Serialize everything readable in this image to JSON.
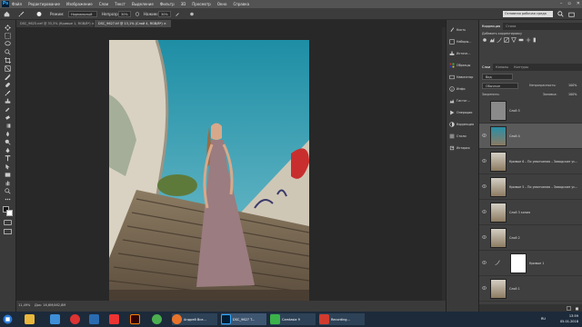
{
  "menubar": {
    "logo": "Ps",
    "items": [
      "Файл",
      "Редактирование",
      "Изображение",
      "Слои",
      "Текст",
      "Выделение",
      "Фильтр",
      "3D",
      "Просмотр",
      "Окно",
      "Справка"
    ],
    "window_buttons": [
      "–",
      "▫",
      "✕"
    ]
  },
  "optbar": {
    "mode_label": "Режим:",
    "mode_value": "Нормальный",
    "opacity_label": "Непрозр.:",
    "opacity_value": "30%",
    "flow_label": "Нажим:",
    "flow_value": "30%",
    "workspace": "Основная рабочая среда"
  },
  "tabs": [
    {
      "label": "DSC_9625.nef @ 33,3% (Кривые 1, RGB/8*) ×",
      "active": false
    },
    {
      "label": "DSC_9627.tif @ 13,1% (Слой 4, RGB/8*) ×",
      "active": true
    }
  ],
  "status": {
    "zoom": "11,49%",
    "doc": "Док: 16,6M/462,8M"
  },
  "strip": {
    "items": [
      {
        "icon": "history-icon",
        "label": "Кисть"
      },
      {
        "icon": "brush-icon",
        "label": "Наборы..."
      },
      {
        "icon": "clone-icon",
        "label": "Источн..."
      },
      {
        "icon": "swatch-icon",
        "label": "Образцы"
      },
      {
        "icon": "navigator-icon",
        "label": "Навигатор"
      },
      {
        "icon": "info-icon",
        "label": "Инфо"
      },
      {
        "icon": "histogram-icon",
        "label": "Гистог..."
      },
      {
        "icon": "actions-icon",
        "label": "Операции"
      },
      {
        "icon": "adjust-icon",
        "label": "Коррекция"
      },
      {
        "icon": "styles-icon",
        "label": "Стили"
      },
      {
        "icon": "history2-icon",
        "label": "История"
      }
    ]
  },
  "panel": {
    "top_tabs": [
      "Коррекция",
      "Стили"
    ],
    "top_hint": "Добавить корректировку",
    "layer_tabs": [
      "Слои",
      "Каналы",
      "Контуры"
    ],
    "kind_label": "Вид",
    "blend_mode": "Обычные",
    "opacity_label": "Непрозрачность:",
    "opacity_value": "100%",
    "lock_label": "Закрепить:",
    "fill_label": "Заливка:",
    "fill_value": "100%",
    "layers": [
      {
        "name": "Слой 5",
        "thumb": "gray",
        "selected": false,
        "eye": false
      },
      {
        "name": "Слой 4",
        "thumb": "photo",
        "selected": true,
        "eye": true
      },
      {
        "name": "Кривые 6 – По умолчанию – Заводские ус...",
        "thumb": "photo",
        "selected": false,
        "eye": true
      },
      {
        "name": "Кривые 5 – По умолчанию – Заводские ус...",
        "thumb": "photo",
        "selected": false,
        "eye": true
      },
      {
        "name": "Слой 3 копия",
        "thumb": "photo",
        "selected": false,
        "eye": true
      },
      {
        "name": "Слой 2",
        "thumb": "photo",
        "selected": false,
        "eye": true
      },
      {
        "name": "Кривые 1",
        "thumb": "white",
        "selected": false,
        "eye": true
      },
      {
        "name": "Слой 1",
        "thumb": "photo",
        "selected": false,
        "eye": true
      }
    ]
  },
  "taskbar": {
    "windows": [
      {
        "label": "Андрей Все...",
        "color": "#e8742b"
      },
      {
        "label": "DSC_9627 T...",
        "color": "#001e36"
      },
      {
        "label": "Camtasia 9",
        "color": "#3bb34a"
      },
      {
        "label": "Recording...",
        "color": "#d13b2e"
      }
    ],
    "lang": "RU",
    "time": "13:59",
    "date": "05.01.2018"
  }
}
